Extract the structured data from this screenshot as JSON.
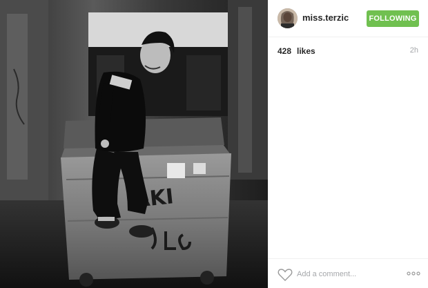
{
  "post": {
    "photo_alt": "Black and white photo of a woman sitting on a graffiti-covered dumpster at night",
    "graffiti_text": "AKI",
    "username": "miss.terzic",
    "follow_label": "FOLLOWING",
    "likes_count": "428",
    "likes_label": "likes",
    "timestamp": "2h",
    "comment_placeholder": "Add a comment...",
    "icons": [
      "heart-icon",
      "more-options-icon"
    ]
  },
  "colors": {
    "follow_button": "#70c050",
    "username": "#262626",
    "muted": "#a5a7aa",
    "divider": "#efefef"
  }
}
